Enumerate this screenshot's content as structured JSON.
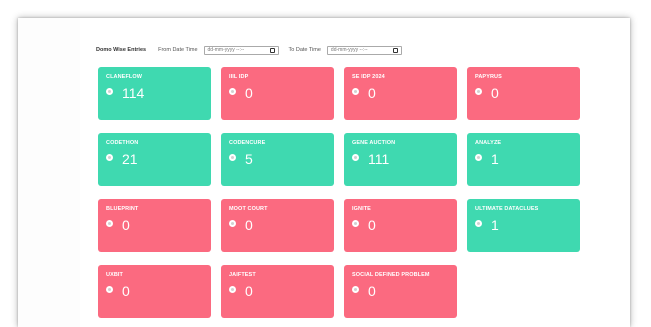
{
  "filters": {
    "title": "Domo Wise Entries",
    "from_label": "From Date Time",
    "from_placeholder": "dd-mm-yyyy --:--",
    "to_label": "To Date Time",
    "to_placeholder": "dd-mm-yyyy --:--"
  },
  "colors": {
    "green": "#3fd9b0",
    "red": "#fb6a80"
  },
  "cards": [
    {
      "name": "ClaneFlow",
      "count": "114",
      "color": "green"
    },
    {
      "name": "IIIL IDP",
      "count": "0",
      "color": "red"
    },
    {
      "name": "SE IDP 2024",
      "count": "0",
      "color": "red"
    },
    {
      "name": "PAPYRUS",
      "count": "0",
      "color": "red"
    },
    {
      "name": "CodeThon",
      "count": "21",
      "color": "green"
    },
    {
      "name": "CODENCURE",
      "count": "5",
      "color": "green"
    },
    {
      "name": "GENE AUCTION",
      "count": "111",
      "color": "green"
    },
    {
      "name": "ANALYZE",
      "count": "1",
      "color": "green"
    },
    {
      "name": "BLUEPRINT",
      "count": "0",
      "color": "red"
    },
    {
      "name": "MOOT COURT",
      "count": "0",
      "color": "red"
    },
    {
      "name": "IGNITE",
      "count": "0",
      "color": "red"
    },
    {
      "name": "Ultimate DataClues",
      "count": "1",
      "color": "green"
    },
    {
      "name": "UxBit",
      "count": "0",
      "color": "red"
    },
    {
      "name": "Jaiftest",
      "count": "0",
      "color": "red"
    },
    {
      "name": "SOCIAL DEFINED PROBLEM",
      "count": "0",
      "color": "red"
    }
  ]
}
